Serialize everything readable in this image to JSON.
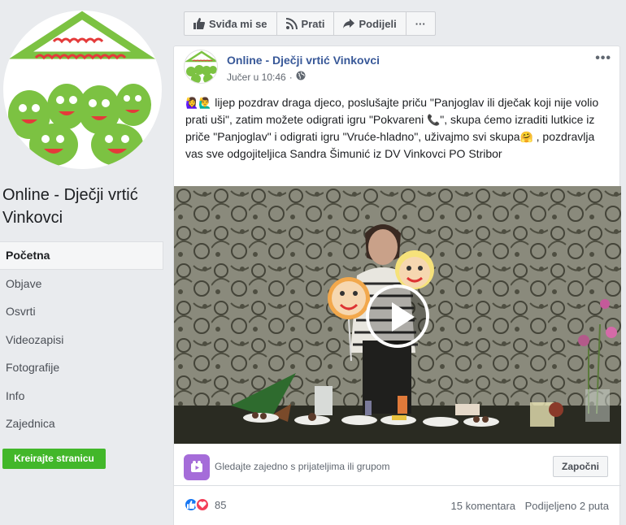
{
  "sidebar": {
    "page_name": "Online - Dječji vrtić Vinkovci",
    "nav": [
      "Početna",
      "Objave",
      "Osvrti",
      "Videozapisi",
      "Fotografije",
      "Info",
      "Zajednica"
    ],
    "create_button": "Kreirajte stranicu"
  },
  "actionbar": {
    "like_label": "Sviđa mi se",
    "follow_label": "Prati",
    "share_label": "Podijeli",
    "more_label": "···"
  },
  "post": {
    "page_name": "Online - Dječji vrtić Vinkovci",
    "time": "Jučer u 10:46",
    "dot": "·",
    "more": "•••",
    "text_part1": "lijep pozdrav draga djeco, poslušajte priču \"Panjoglav ili dječak koji nije volio prati uši\", zatim možete odigrati igru \"Pokvareni ",
    "text_part2": "\", skupa ćemo izraditi lutkice iz priče \"Panjoglav\" i odigrati igru \"Vruće-hladno\", uživajmo svi skupa",
    "text_part3": ", pozdravlja vas sve odgojiteljica Sandra Šimunić iz DV Vinkovci PO Stribor",
    "emoji_start": "🙋‍♀️🙋‍♂️",
    "emoji_phone": "📞",
    "emoji_hug": "🤗"
  },
  "watch": {
    "text": "Gledajte zajedno s prijateljima ili grupom",
    "button": "Započni"
  },
  "reactions": {
    "count": "85"
  },
  "stats": {
    "comments": "15 komentara",
    "shares": "Podijeljeno 2 puta"
  },
  "colors": {
    "accent": "#385898",
    "create_button": "#42b72a",
    "like": "#1877f2",
    "love": "#f33e58"
  }
}
